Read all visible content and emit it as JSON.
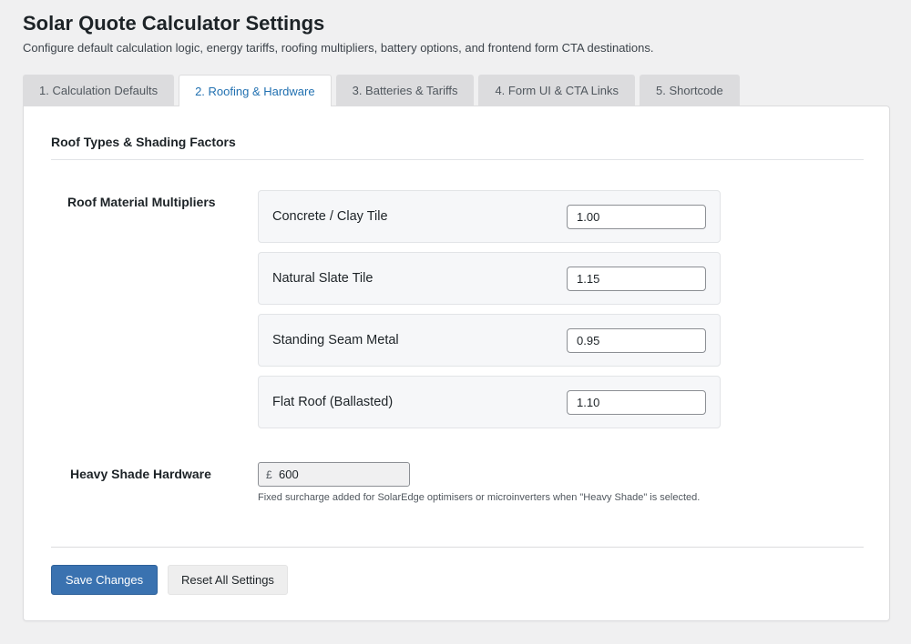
{
  "header": {
    "title": "Solar Quote Calculator Settings",
    "description": "Configure default calculation logic, energy tariffs, roofing multipliers, battery options, and frontend form CTA destinations."
  },
  "tabs": [
    {
      "label": "1. Calculation Defaults",
      "active": false
    },
    {
      "label": "2. Roofing & Hardware",
      "active": true
    },
    {
      "label": "3. Batteries & Tariffs",
      "active": false
    },
    {
      "label": "4. Form UI & CTA Links",
      "active": false
    },
    {
      "label": "5. Shortcode",
      "active": false
    }
  ],
  "section": {
    "title": "Roof Types & Shading Factors"
  },
  "roof_multipliers": {
    "label": "Roof Material Multipliers",
    "items": [
      {
        "label": "Concrete / Clay Tile",
        "value": "1.00"
      },
      {
        "label": "Natural Slate Tile",
        "value": "1.15"
      },
      {
        "label": "Standing Seam Metal",
        "value": "0.95"
      },
      {
        "label": "Flat Roof (Ballasted)",
        "value": "1.10"
      }
    ]
  },
  "heavy_shade": {
    "label": "Heavy Shade Hardware",
    "currency": "£",
    "value": "600",
    "hint": "Fixed surcharge added for SolarEdge optimisers or microinverters when \"Heavy Shade\" is selected."
  },
  "actions": {
    "save_label": "Save Changes",
    "reset_label": "Reset All Settings"
  },
  "colors": {
    "accent": "#2271b1",
    "primary_button": "#3a72b0",
    "background": "#f0f0f1"
  }
}
